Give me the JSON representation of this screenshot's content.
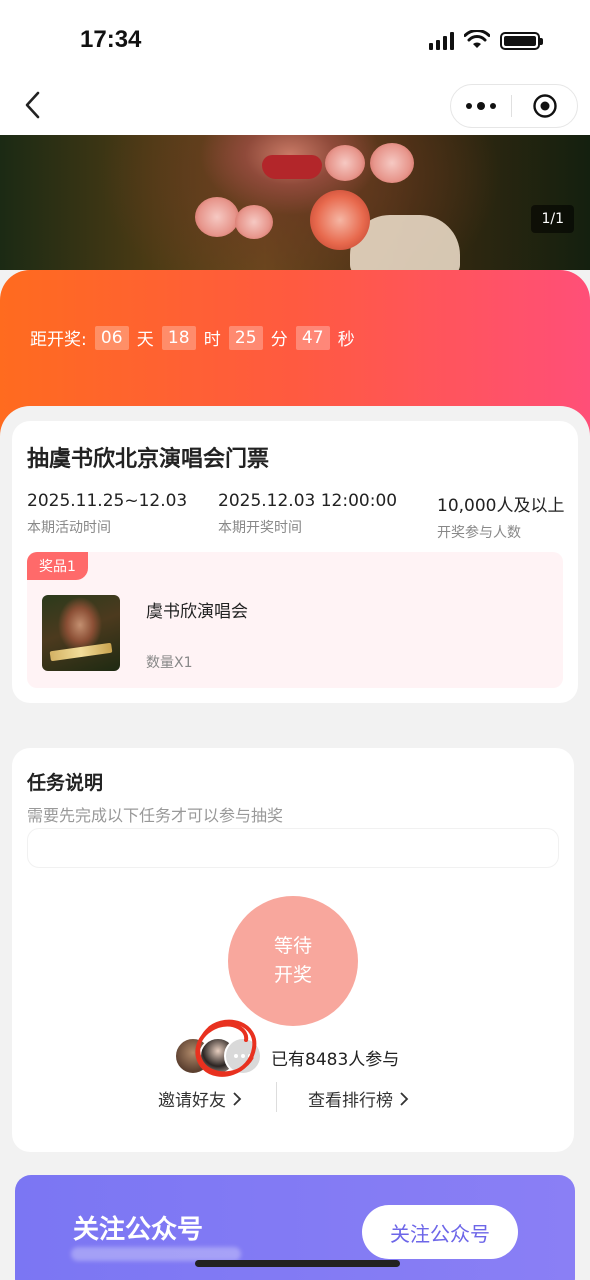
{
  "status_bar": {
    "time": "17:34"
  },
  "banner": {
    "index": "1/1"
  },
  "countdown": {
    "label": "距开奖:",
    "days": "06",
    "days_unit": "天",
    "hours": "18",
    "hours_unit": "时",
    "minutes": "25",
    "minutes_unit": "分",
    "seconds": "47",
    "seconds_unit": "秒"
  },
  "event": {
    "title": "抽虞书欣北京演唱会门票",
    "stats": [
      {
        "value": "2025.11.25~12.03",
        "label": "本期活动时间"
      },
      {
        "value": "2025.12.03 12:00:00",
        "label": "本期开奖时间"
      },
      {
        "value": "10,000人及以上",
        "label": "开奖参与人数"
      }
    ],
    "prize": {
      "tag": "奖品1",
      "name": "虞书欣演唱会",
      "quantity": "数量X1"
    }
  },
  "task": {
    "title": "任务说明",
    "description": "需要先完成以下任务才可以参与抽奖",
    "draw_button": {
      "line1": "等待",
      "line2": "开奖"
    },
    "participants": "已有8483人参与",
    "invite_link": "邀请好友",
    "ranking_link": "查看排行榜"
  },
  "follow": {
    "title": "关注公众号",
    "button": "关注公众号"
  },
  "colors": {
    "accent_orange": "#ff6b1f",
    "accent_pink": "#ff4f78",
    "follow_purple": "#7b76f3",
    "draw_button": "#f8a79d"
  }
}
